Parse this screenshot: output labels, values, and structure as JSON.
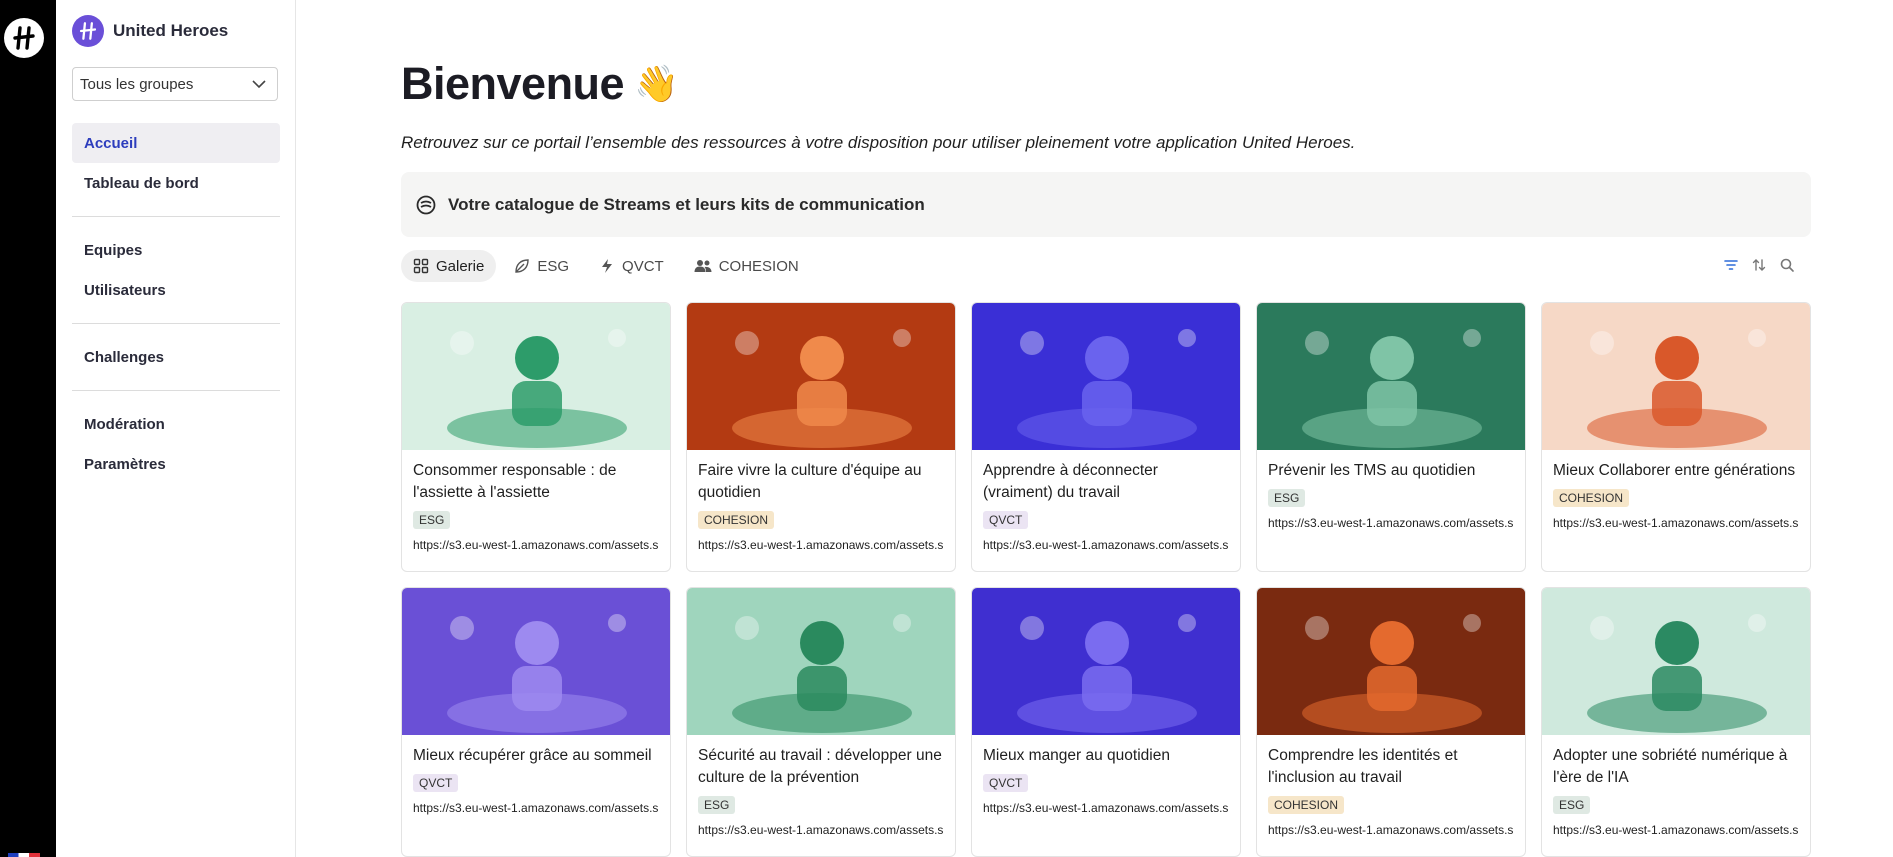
{
  "app": {
    "name": "United Heroes"
  },
  "group_select": {
    "value": "Tous les groupes"
  },
  "nav": {
    "section1": [
      {
        "label": "Accueil",
        "active": true
      },
      {
        "label": "Tableau de bord"
      }
    ],
    "section2": [
      {
        "label": "Equipes"
      },
      {
        "label": "Utilisateurs"
      }
    ],
    "section3": [
      {
        "label": "Challenges"
      }
    ],
    "section4": [
      {
        "label": "Modération"
      },
      {
        "label": "Paramètres"
      }
    ]
  },
  "page": {
    "title": "Bienvenue",
    "subtitle": "Retrouvez sur ce portail l’ensemble des ressources à votre disposition pour utiliser pleinement votre application United Heroes.",
    "catalog_label": "Votre catalogue de Streams et leurs kits de communication"
  },
  "tabs": [
    {
      "label": "Galerie",
      "icon": "gallery-icon"
    },
    {
      "label": "ESG",
      "icon": "leaf-icon"
    },
    {
      "label": "QVCT",
      "icon": "bolt-icon"
    },
    {
      "label": "COHESION",
      "icon": "people-icon"
    }
  ],
  "cards": [
    {
      "title": "Consommer responsable : de l'assiette à l'assiette",
      "tag": "ESG",
      "url": "https://s3.eu-west-1.amazonaws.com/assets.s",
      "colors": [
        "#d9efe3",
        "#2d9c6a"
      ]
    },
    {
      "title": "Faire vivre la culture d'équipe au quotidien",
      "tag": "COHESION",
      "url": "https://s3.eu-west-1.amazonaws.com/assets.s",
      "colors": [
        "#b33a12",
        "#f08a4b"
      ]
    },
    {
      "title": "Apprendre à déconnecter (vraiment) du travail",
      "tag": "QVCT",
      "url": "https://s3.eu-west-1.amazonaws.com/assets.s",
      "colors": [
        "#3a2fd6",
        "#6a63ee"
      ]
    },
    {
      "title": "Prévenir les TMS au quotidien",
      "tag": "ESG",
      "url": "https://s3.eu-west-1.amazonaws.com/assets.s",
      "colors": [
        "#2b7a5c",
        "#7fc4a6"
      ]
    },
    {
      "title": "Mieux Collaborer entre générations",
      "tag": "COHESION",
      "url": "https://s3.eu-west-1.amazonaws.com/assets.s",
      "colors": [
        "#f6d8c6",
        "#d9582a"
      ]
    },
    {
      "title": "Mieux récupérer grâce au sommeil",
      "tag": "QVCT",
      "url": "https://s3.eu-west-1.amazonaws.com/assets.s",
      "colors": [
        "#6a50d6",
        "#9d8af0"
      ]
    },
    {
      "title": "Sécurité au travail : développer une culture de la prévention",
      "tag": "ESG",
      "url": "https://s3.eu-west-1.amazonaws.com/assets.s",
      "colors": [
        "#9fd5bd",
        "#2a8a5e"
      ]
    },
    {
      "title": "Mieux manger au quotidien",
      "tag": "QVCT",
      "url": "https://s3.eu-west-1.amazonaws.com/assets.s",
      "colors": [
        "#3f2fd0",
        "#7a6cf0"
      ]
    },
    {
      "title": "Comprendre les identités et l'inclusion au travail",
      "tag": "COHESION",
      "url": "https://s3.eu-west-1.amazonaws.com/assets.s",
      "colors": [
        "#7a2a10",
        "#e46a2e"
      ]
    },
    {
      "title": "Adopter une sobriété numérique à l'ère de l'IA",
      "tag": "ESG",
      "url": "https://s3.eu-west-1.amazonaws.com/assets.s",
      "colors": [
        "#cfe9dd",
        "#2b8a62"
      ]
    }
  ]
}
